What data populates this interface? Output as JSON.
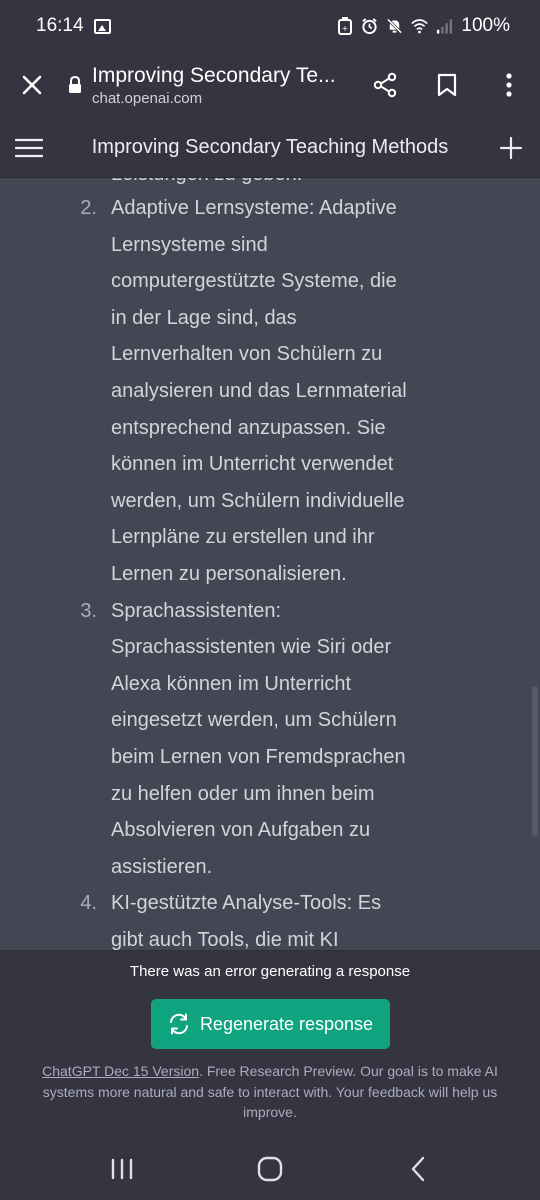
{
  "status_bar": {
    "time": "16:14",
    "battery": "100%"
  },
  "browser": {
    "title": "Improving Secondary Te...",
    "url": "chat.openai.com"
  },
  "app_header": {
    "title": "Improving Secondary Teaching Methods"
  },
  "content": {
    "partial_line": "Leistungen zu geben.",
    "items": [
      {
        "number": "2.",
        "lines": [
          "Adaptive Lernsysteme: Adaptive",
          "Lernsysteme sind",
          "computergestützte Systeme, die",
          "in der Lage sind, das",
          "Lernverhalten von Schülern zu",
          "analysieren und das Lernmaterial",
          "entsprechend anzupassen. Sie",
          "können im Unterricht verwendet",
          "werden, um Schülern individuelle",
          "Lernpläne zu erstellen und ihr",
          "Lernen zu personalisieren."
        ]
      },
      {
        "number": "3.",
        "lines": [
          "Sprachassistenten:",
          "Sprachassistenten wie Siri oder",
          "Alexa können im Unterricht",
          "eingesetzt werden, um Schülern",
          "beim Lernen von Fremdsprachen",
          "zu helfen oder um ihnen beim",
          "Absolvieren von Aufgaben zu",
          "assistieren."
        ]
      },
      {
        "number": "4.",
        "lines": [
          "KI-gestützte Analyse-Tools: Es",
          "gibt auch Tools, die mit KI"
        ]
      }
    ]
  },
  "bottom": {
    "error_text": "There was an error generating a response",
    "regenerate_label": "Regenerate response",
    "footer_link": "ChatGPT Dec 15 Version",
    "footer_text": ". Free Research Preview. Our goal is to make AI systems more natural and safe to interact with. Your feedback will help us improve."
  },
  "colors": {
    "accent": "#10a37f",
    "header_bg": "#343541",
    "content_bg": "#444654"
  },
  "icons": {
    "browser": [
      "close-icon",
      "lock-icon",
      "share-icon",
      "bookmark-icon",
      "more-vert-icon"
    ],
    "app": [
      "hamburger-menu-icon",
      "plus-icon",
      "refresh-icon"
    ],
    "nav": [
      "recents-icon",
      "home-icon",
      "back-icon"
    ]
  }
}
